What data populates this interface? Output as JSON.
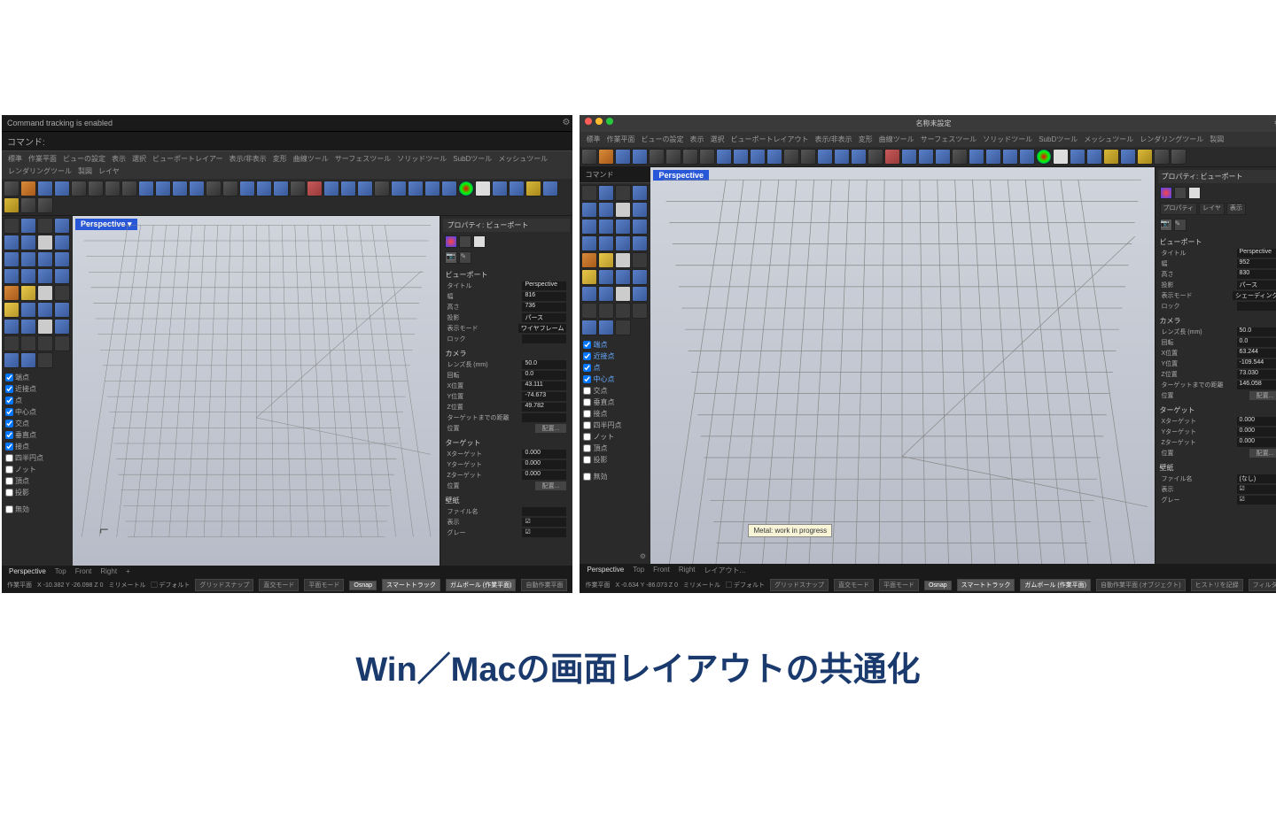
{
  "caption": "Win／Macの画面レイアウトの共通化",
  "win": {
    "cmdTracking": "Command tracking is enabled",
    "cmdPrompt": "コマンド:",
    "menubar": [
      "標準",
      "作業平面",
      "ビューの設定",
      "表示",
      "選択",
      "ビューポートレイアー",
      "表示/非表示",
      "変形",
      "曲線ツール",
      "サーフェスツール",
      "ソリッドツール",
      "SubDツール",
      "メッシュツール",
      "レンダリングツール",
      "製図",
      "レイヤ"
    ],
    "vpLabel": "Perspective ▾",
    "osnap": [
      {
        "l": "端点",
        "c": true
      },
      {
        "l": "近接点",
        "c": true
      },
      {
        "l": "点",
        "c": true
      },
      {
        "l": "中心点",
        "c": true
      },
      {
        "l": "交点",
        "c": true
      },
      {
        "l": "垂直点",
        "c": true
      },
      {
        "l": "接点",
        "c": true
      },
      {
        "l": "四半円点",
        "c": false
      },
      {
        "l": "ノット",
        "c": false
      },
      {
        "l": "頂点",
        "c": false
      },
      {
        "l": "投影",
        "c": false
      }
    ],
    "osnapDisable": "無効",
    "panel": {
      "title": "プロパティ: ビューポート",
      "sect1": "ビューポート",
      "rows1": [
        [
          "タイトル",
          "Perspective"
        ],
        [
          "幅",
          "816"
        ],
        [
          "高さ",
          "736"
        ],
        [
          "投影",
          "パース"
        ],
        [
          "表示モード",
          "ワイヤフレーム"
        ],
        [
          "ロック",
          ""
        ]
      ],
      "sect2": "カメラ",
      "rows2": [
        [
          "レンズ長 (mm)",
          "50.0"
        ],
        [
          "回転",
          "0.0"
        ],
        [
          "X位置",
          "43.111"
        ],
        [
          "Y位置",
          "-74.673"
        ],
        [
          "Z位置",
          "49.782"
        ],
        [
          "ターゲットまでの距離",
          ""
        ]
      ],
      "place": "配置...",
      "sect3": "ターゲット",
      "rows3": [
        [
          "Xターゲット",
          "0.000"
        ],
        [
          "Yターゲット",
          "0.000"
        ],
        [
          "Zターゲット",
          "0.000"
        ]
      ],
      "sect4": "壁紙",
      "rows4": [
        [
          "ファイル名",
          ""
        ],
        [
          "表示",
          "☑"
        ],
        [
          "グレー",
          "☑"
        ]
      ]
    },
    "vtabs": [
      "Perspective",
      "Top",
      "Front",
      "Right",
      "+"
    ],
    "status": {
      "cplane": "作業平面",
      "coords": "X -10.382  Y -26.098  Z 0",
      "units": "ミリメートル",
      "layer": "デフォルト",
      "items": [
        "グリッドスナップ",
        "直交モード",
        "平面モード",
        "Osnap",
        "スマートトラック",
        "ガムボール (作業平面)",
        "自動作業平面"
      ]
    }
  },
  "mac": {
    "title": "名称未設定",
    "menubar": [
      "標準",
      "作業平面",
      "ビューの設定",
      "表示",
      "選択",
      "ビューポートレイアウト",
      "表示/非表示",
      "変形",
      "曲線ツール",
      "サーフェスツール",
      "ソリッドツール",
      "SubDツール",
      "メッシュツール",
      "レンダリングツール",
      "製図"
    ],
    "cmdPrompt": "コマンド",
    "vpLabel": "Perspective",
    "tooltip": "Metal: work in progress",
    "osnap": [
      {
        "l": "端点",
        "c": true,
        "b": true
      },
      {
        "l": "近接点",
        "c": true,
        "b": true
      },
      {
        "l": "点",
        "c": true,
        "b": true
      },
      {
        "l": "中心点",
        "c": true,
        "b": true
      },
      {
        "l": "交点",
        "c": false
      },
      {
        "l": "垂直点",
        "c": false
      },
      {
        "l": "接点",
        "c": false
      },
      {
        "l": "四半円点",
        "c": false
      },
      {
        "l": "ノット",
        "c": false
      },
      {
        "l": "頂点",
        "c": false
      },
      {
        "l": "投影",
        "c": false
      }
    ],
    "osnapDisable": "無効",
    "panel": {
      "title": "プロパティ: ビューポート",
      "tabs": [
        "プロパティ",
        "レイヤ",
        "表示"
      ],
      "sect1": "ビューポート",
      "rows1": [
        [
          "タイトル",
          "Perspective"
        ],
        [
          "幅",
          "952"
        ],
        [
          "高さ",
          "830"
        ],
        [
          "投影",
          "パース"
        ],
        [
          "表示モード",
          "シェーディング"
        ],
        [
          "ロック",
          ""
        ]
      ],
      "sect2": "カメラ",
      "rows2": [
        [
          "レンズ長 (mm)",
          "50.0"
        ],
        [
          "回転",
          "0.0"
        ],
        [
          "X位置",
          "63.244"
        ],
        [
          "Y位置",
          "-109.544"
        ],
        [
          "Z位置",
          "73.030"
        ],
        [
          "ターゲットまでの距離",
          "146.058"
        ]
      ],
      "place": "配置...",
      "sect3": "ターゲット",
      "rows3": [
        [
          "Xターゲット",
          "0.000"
        ],
        [
          "Yターゲット",
          "0.000"
        ],
        [
          "Zターゲット",
          "0.000"
        ]
      ],
      "sect4": "壁紙",
      "rows4": [
        [
          "ファイル名",
          "(なし)"
        ],
        [
          "表示",
          "☑"
        ],
        [
          "グレー",
          "☑"
        ]
      ]
    },
    "vtabs": [
      "Perspective",
      "Top",
      "Front",
      "Right",
      "レイアウト..."
    ],
    "status": {
      "cplane": "作業平面",
      "coords": "X -0.634  Y -86.073  Z 0",
      "units": "ミリメートル",
      "layer": "デフォルト",
      "items": [
        "グリッドスナップ",
        "直交モード",
        "平面モード",
        "Osnap",
        "スマートトラック",
        "ガムボール (作業平面)",
        "自動作業平面 (オブジェクト)",
        "ヒストリを記録",
        "フィルタ"
      ]
    }
  }
}
